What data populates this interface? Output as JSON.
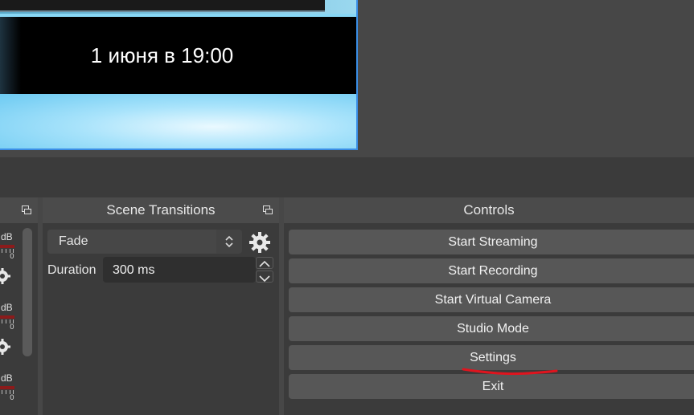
{
  "preview": {
    "caption": "1 июня в 19:00"
  },
  "mixer": {
    "db_labels": [
      "dB",
      "dB",
      "dB"
    ],
    "zero_labels": [
      "0",
      "0",
      "0"
    ],
    "meter_color": "#8c1b1b"
  },
  "transitions": {
    "title": "Scene Transitions",
    "selected": "Fade",
    "duration_label": "Duration",
    "duration_value": "300 ms"
  },
  "controls": {
    "title": "Controls",
    "buttons": [
      "Start Streaming",
      "Start Recording",
      "Start Virtual Camera",
      "Studio Mode",
      "Settings",
      "Exit"
    ]
  },
  "colors": {
    "accent": "#3a8ee6",
    "annotation": "#e0141e"
  },
  "icons": {
    "float": "float-dock-icon",
    "gear": "gear-icon",
    "spin_arrows": "up-down-arrows-icon"
  }
}
